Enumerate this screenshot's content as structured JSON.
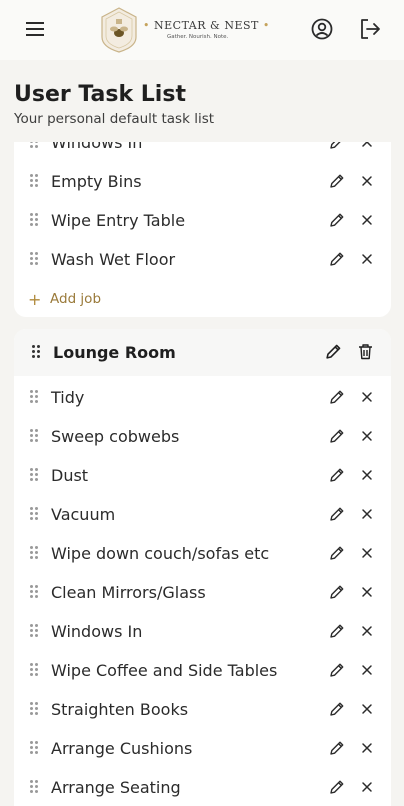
{
  "brand": {
    "name": "NECTAR & NEST",
    "dot": "•",
    "tagline": "Gather. Nourish. Note."
  },
  "icons": {
    "menu": "menu-icon",
    "account": "user-circle-icon",
    "logout": "logout-icon",
    "drag": "drag-handle-icon",
    "edit": "pencil-icon",
    "remove": "close-icon",
    "delete": "trash-icon",
    "add": "plus-icon"
  },
  "colors": {
    "accent": "#c5a35c",
    "background": "#f5f4f1",
    "card": "#ffffff"
  },
  "page": {
    "title": "User Task List",
    "subtitle": "Your personal default task list"
  },
  "rooms": [
    {
      "tasks": [
        "Windows In",
        "Empty Bins",
        "Wipe Entry Table",
        "Wash Wet Floor"
      ],
      "add_label": "Add job",
      "add_symbol": "+"
    },
    {
      "name": "Lounge Room",
      "tasks": [
        "Tidy",
        "Sweep cobwebs",
        "Dust",
        "Vacuum",
        "Wipe down couch/sofas etc",
        "Clean Mirrors/Glass",
        "Windows In",
        "Wipe Coffee and Side Tables",
        "Straighten Books",
        "Arrange Cushions",
        "Arrange Seating"
      ]
    }
  ]
}
